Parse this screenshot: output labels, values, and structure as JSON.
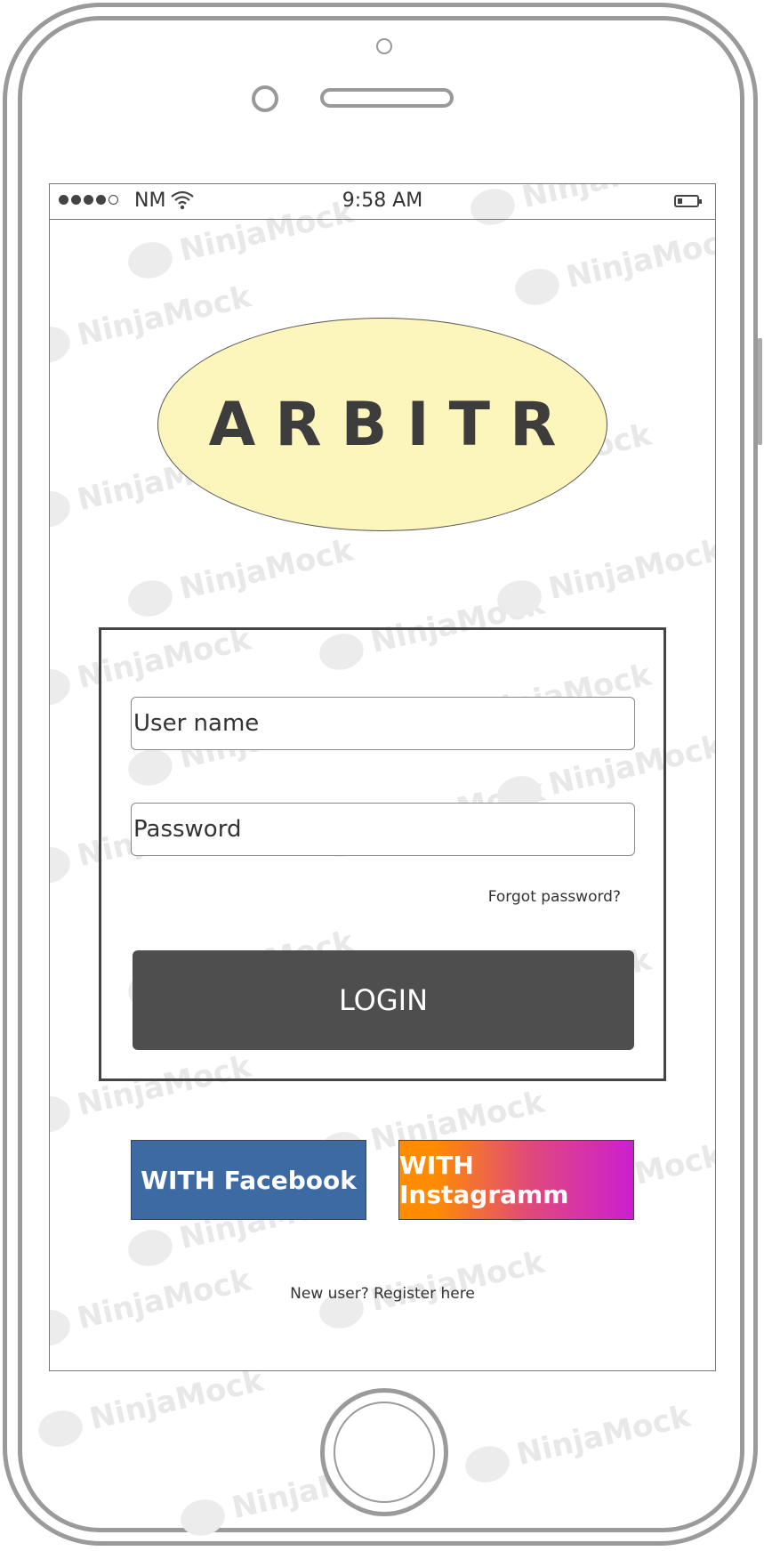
{
  "status_bar": {
    "carrier": "NM",
    "time": "9:58 AM"
  },
  "watermark": "NinjaMock",
  "logo": {
    "text": "ARBITR",
    "bg_color": "#fcf6bd"
  },
  "login_form": {
    "username_placeholder": "User name",
    "password_placeholder": "Password",
    "forgot_label": "Forgot password?",
    "login_label": "LOGIN"
  },
  "social": {
    "facebook_label": "WITH Facebook",
    "instagram_label": "WITH Instagramm",
    "facebook_color": "#3d6aa3"
  },
  "register_label": "New user? Register here"
}
